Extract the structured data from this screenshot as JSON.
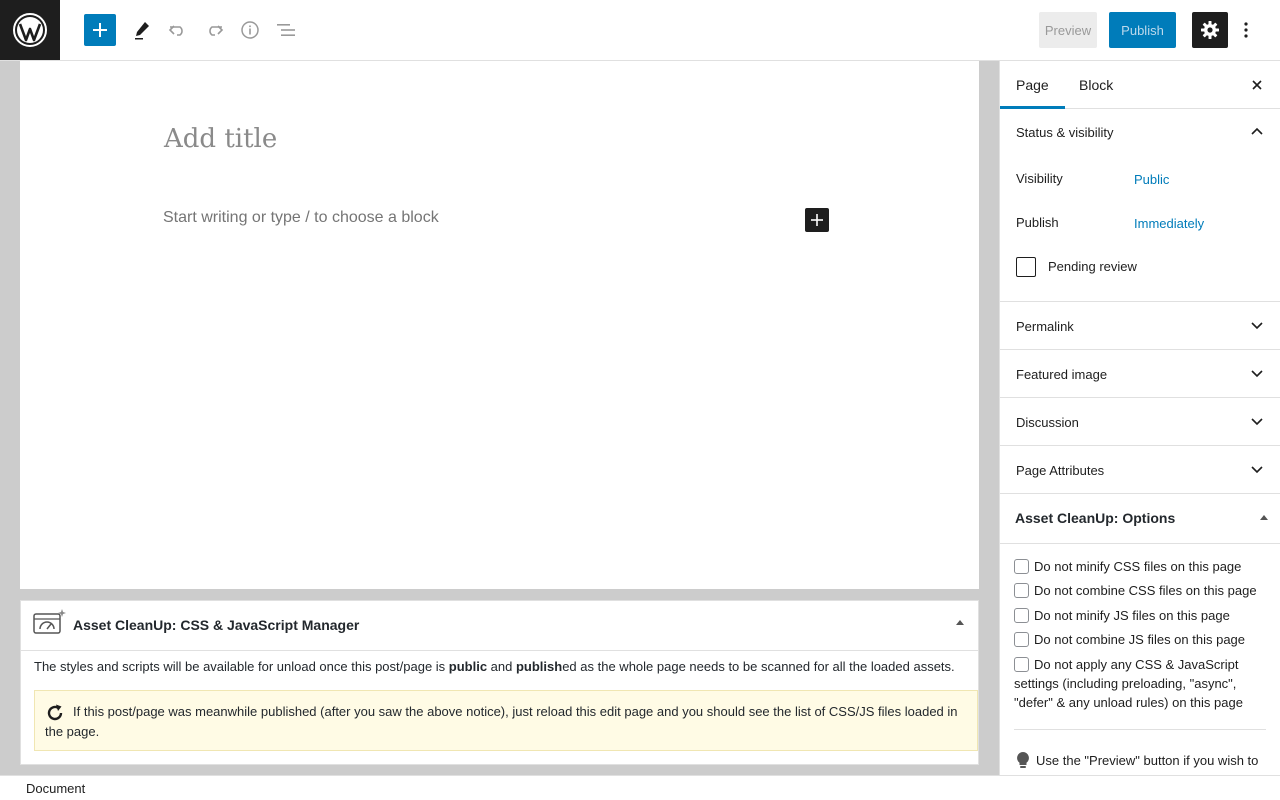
{
  "toolbar": {
    "preview_label": "Preview",
    "publish_label": "Publish"
  },
  "editor": {
    "title_placeholder": "Add title",
    "block_placeholder": "Start writing or type / to choose a block"
  },
  "metabox": {
    "title": "Asset CleanUp: CSS & JavaScript Manager",
    "text_pre": "The styles and scripts will be available for unload once this post/page is ",
    "text_bold1": "public",
    "text_mid": " and ",
    "text_bold2": "publish",
    "text_post": "ed as the whole page needs to be scanned for all the loaded assets.",
    "notice": "If this post/page was meanwhile published (after you saw the above notice), just reload this edit page and you should see the list of CSS/JS files loaded in the page."
  },
  "sidebar": {
    "tab_page": "Page",
    "tab_block": "Block",
    "status_title": "Status & visibility",
    "visibility_label": "Visibility",
    "visibility_value": "Public",
    "publish_label": "Publish",
    "publish_value": "Immediately",
    "pending_label": "Pending review",
    "panels": [
      "Permalink",
      "Featured image",
      "Discussion",
      "Page Attributes"
    ],
    "assetcleanup_title": "Asset CleanUp: Options",
    "options": [
      "Do not minify CSS files on this page",
      "Do not combine CSS files on this page",
      "Do not minify JS files on this page",
      "Do not combine JS files on this page",
      "Do not apply any CSS & JavaScript settings (including preloading, \"async\", \"defer\" & any unload rules) on this page"
    ],
    "preview_hint": "Use the \"Preview\" button if you wish to"
  },
  "footer": {
    "breadcrumb": "Document"
  },
  "colors": {
    "accent": "#007cba",
    "dark": "#1e1e1e",
    "notice_bg": "#fffbe5"
  }
}
